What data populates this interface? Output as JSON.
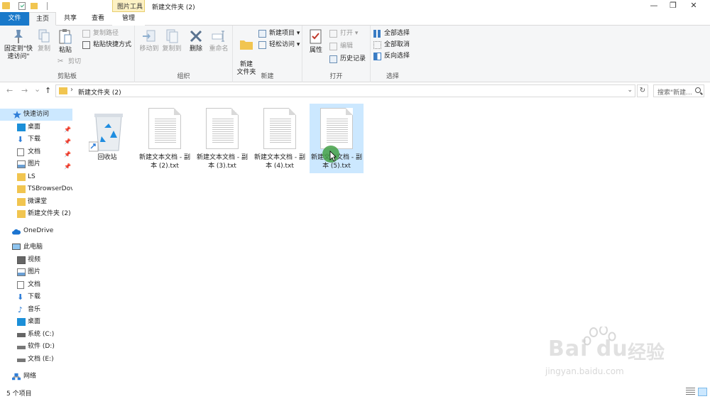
{
  "window": {
    "title": "新建文件夹 (2)",
    "context_tab": "图片工具",
    "controls": {
      "minimize": "—",
      "maximize": "❐",
      "close": "✕"
    }
  },
  "tabs": [
    {
      "label": "文件"
    },
    {
      "label": "主页"
    },
    {
      "label": "共享"
    },
    {
      "label": "查看"
    },
    {
      "label": "管理"
    }
  ],
  "ribbon": {
    "clipboard": {
      "label": "剪贴板",
      "pin": "固定到\"快速访问\"",
      "copy": "复制",
      "paste": "粘贴",
      "copy_path": "复制路径",
      "paste_shortcut": "粘贴快捷方式",
      "cut": "剪切"
    },
    "organize": {
      "label": "组织",
      "move_to": "移动到",
      "copy_to": "复制到",
      "delete": "删除",
      "rename": "重命名"
    },
    "new": {
      "label": "新建",
      "new_folder": "新建\n文件夹",
      "new_item": "新建项目",
      "easy_access": "轻松访问"
    },
    "open": {
      "label": "打开",
      "properties": "属性",
      "open": "打开",
      "edit": "编辑",
      "history": "历史记录"
    },
    "select": {
      "label": "选择",
      "select_all": "全部选择",
      "select_none": "全部取消",
      "invert": "反向选择"
    }
  },
  "address": {
    "path": "新建文件夹 (2)",
    "search_placeholder": "搜索\"新建...",
    "back": "←",
    "forward": "→",
    "recent": "⌄",
    "up": "↑",
    "refresh": "↻",
    "dropdown": "⌄",
    "separator": "›"
  },
  "nav": {
    "quick_access": "快速访问",
    "quick_items": [
      "桌面",
      "下载",
      "文档",
      "图片",
      "LS",
      "TSBrowserDov",
      "微课堂",
      "新建文件夹 (2)"
    ],
    "onedrive": "OneDrive",
    "this_pc": "此电脑",
    "pc_items": [
      "视频",
      "图片",
      "文档",
      "下载",
      "音乐",
      "桌面",
      "系统 (C:)",
      "软件 (D:)",
      "文档 (E:)"
    ],
    "network": "网络"
  },
  "files": [
    {
      "name": "回收站",
      "type": "recycle-bin"
    },
    {
      "name": "新建文本文档 - 副本 (2).txt",
      "type": "txt"
    },
    {
      "name": "新建文本文档 - 副本 (3).txt",
      "type": "txt"
    },
    {
      "name": "新建文本文档 - 副本 (4).txt",
      "type": "txt"
    },
    {
      "name": "新建文本文档 - 副本 (5).txt",
      "type": "txt",
      "selected": true
    }
  ],
  "status": {
    "count": "5 个项目"
  },
  "watermark": {
    "brand": "Bai du",
    "cn": "经验",
    "url": "jingyan.baidu.com"
  }
}
